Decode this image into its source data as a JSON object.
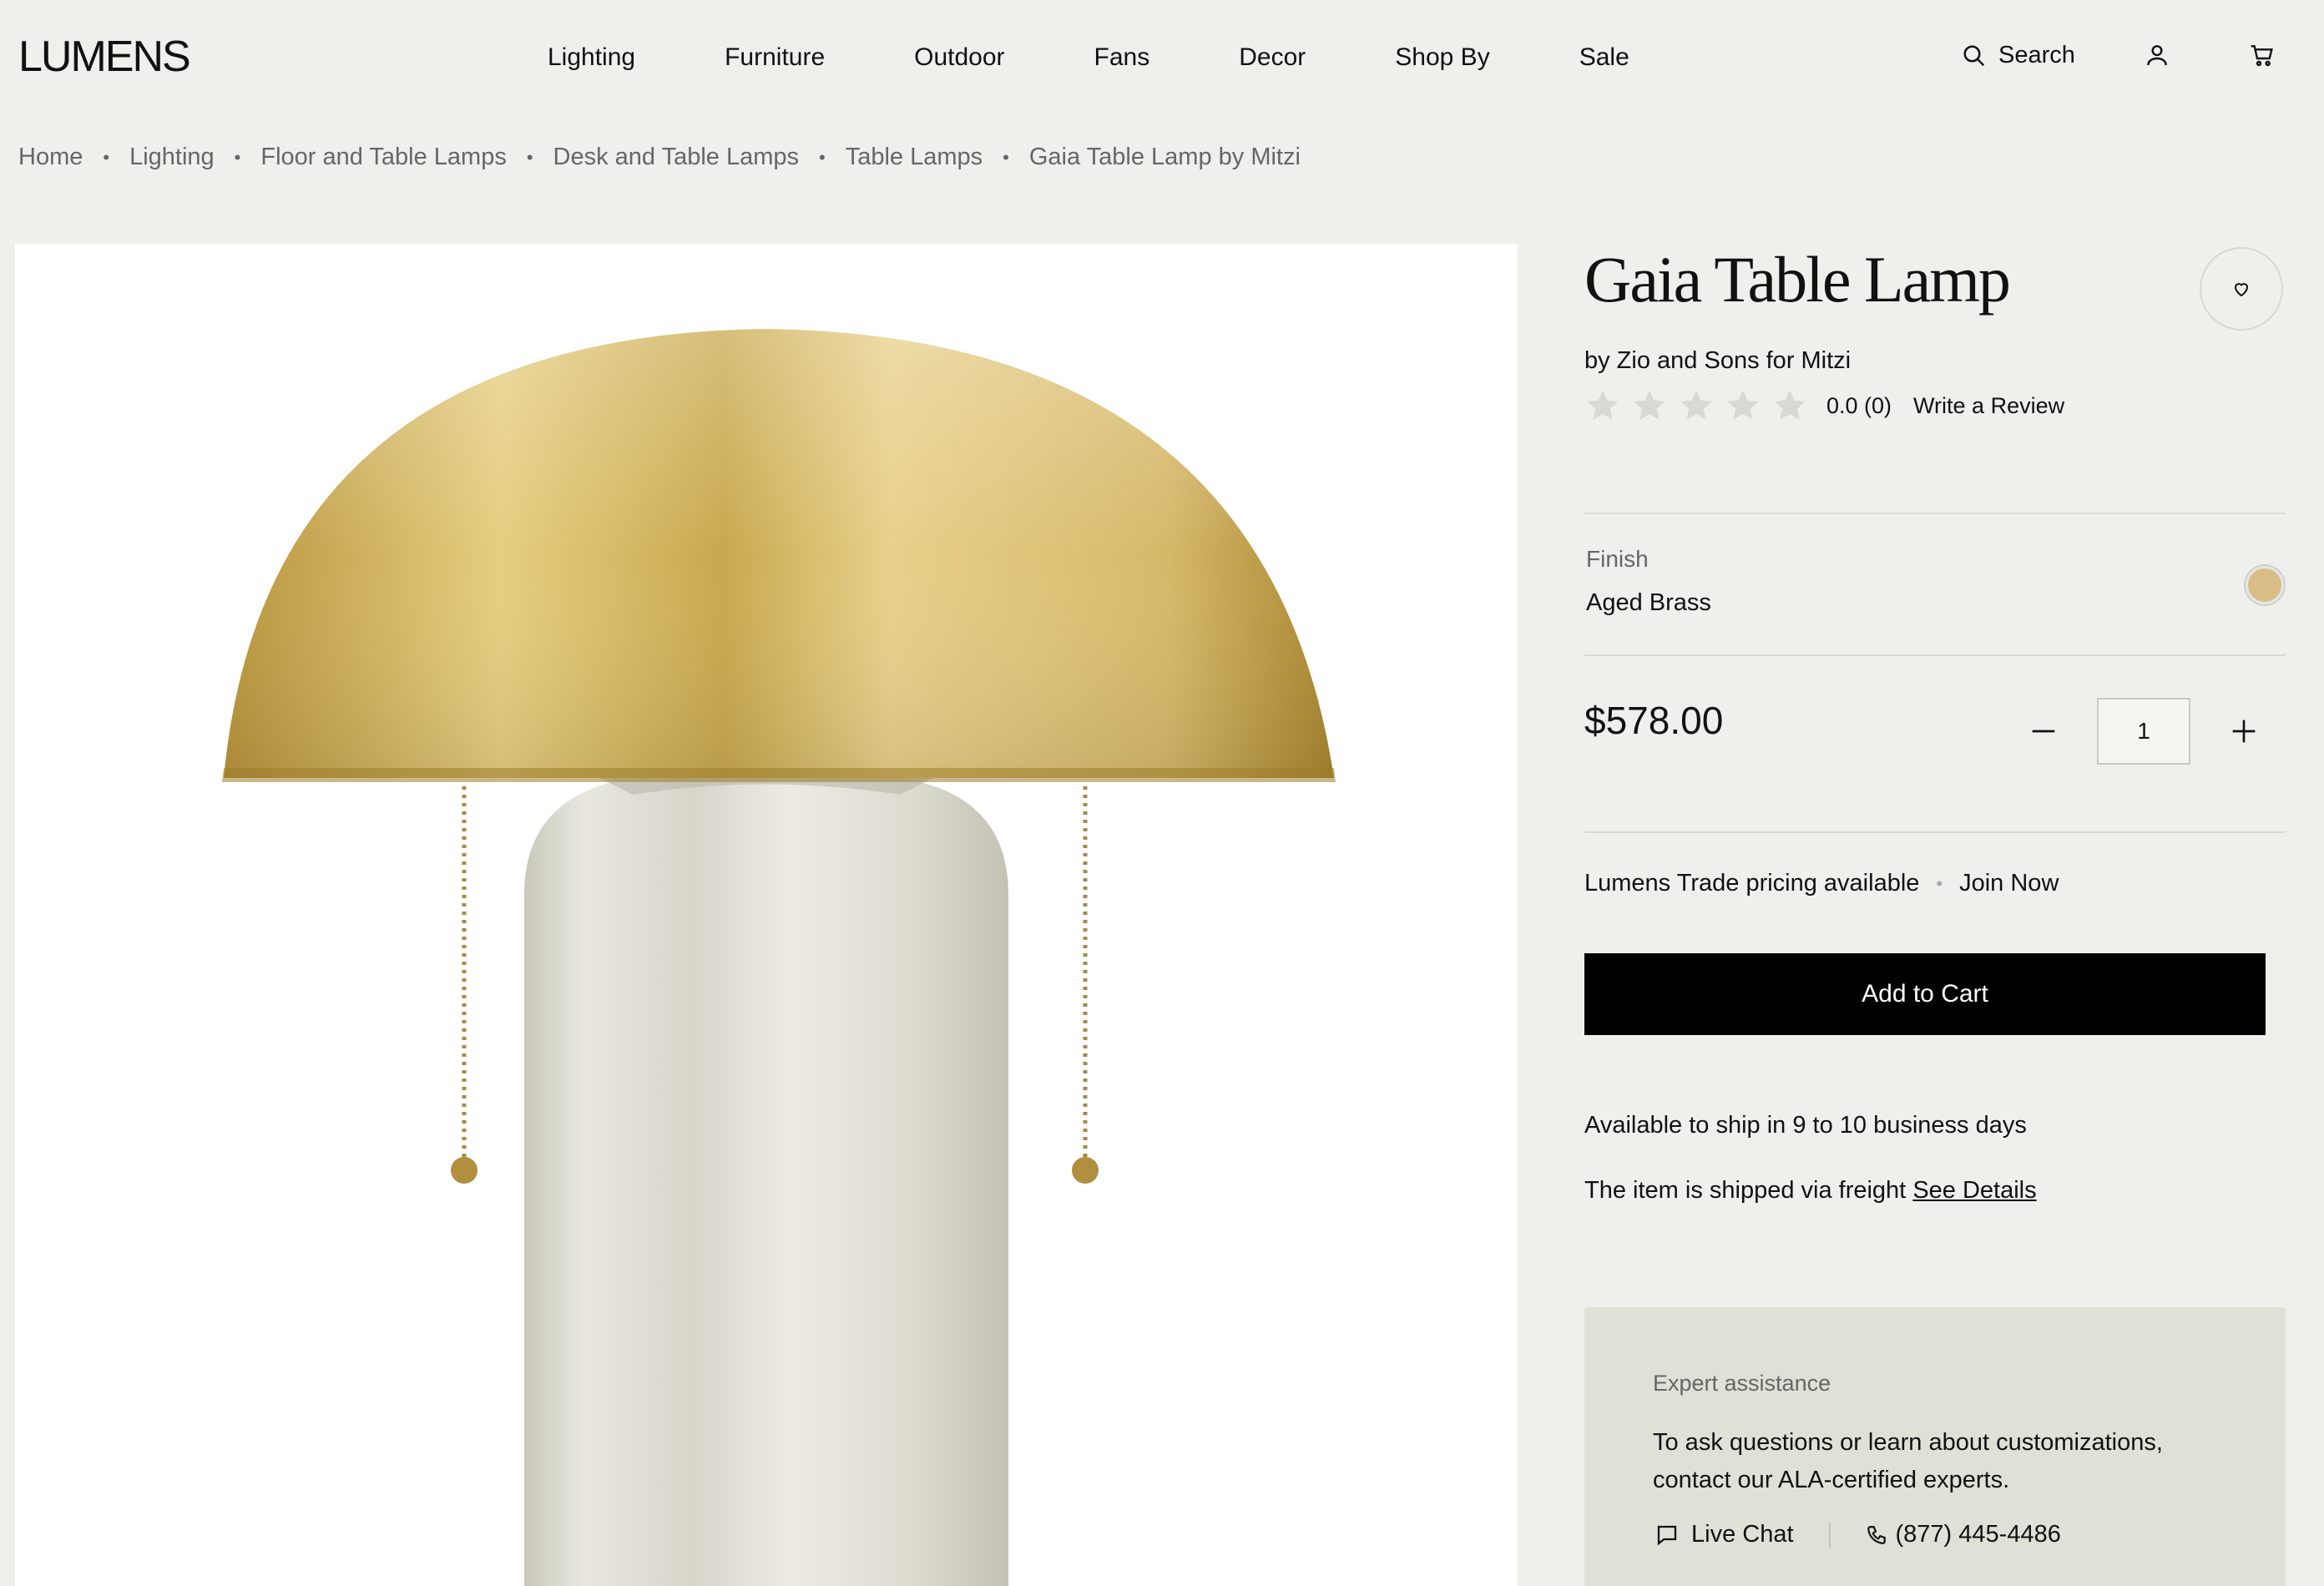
{
  "header": {
    "logo": "LUMENS",
    "nav": [
      "Lighting",
      "Furniture",
      "Outdoor",
      "Fans",
      "Decor",
      "Shop By",
      "Sale"
    ],
    "search_label": "Search"
  },
  "breadcrumb": [
    "Home",
    "Lighting",
    "Floor and Table Lamps",
    "Desk and Table Lamps",
    "Table Lamps",
    "Gaia Table Lamp by Mitzi"
  ],
  "product": {
    "title": "Gaia Table Lamp",
    "brand": "by Zio and Sons for Mitzi",
    "rating": {
      "stars_filled": 0,
      "stars_total": 5,
      "value_text": "0.0 (0)",
      "write_review": "Write a Review"
    },
    "finish": {
      "label": "Finish",
      "value": "Aged Brass",
      "swatch_color": "#d9bc86"
    },
    "price": "$578.00",
    "quantity": "1",
    "trade_text": "Lumens Trade pricing available",
    "trade_join": "Join Now",
    "add_to_cart": "Add to Cart",
    "shipping": "Available to ship in 9 to 10 business days",
    "freight_text": "The item is shipped via freight ",
    "freight_link": "See Details"
  },
  "expert": {
    "title": "Expert assistance",
    "body": "To ask questions or learn about customizations, contact our ALA-certified experts.",
    "live_chat": "Live Chat",
    "phone": "(877) 445-4486"
  },
  "colors": {
    "page_bg": "#eff0ec",
    "button_bg": "#000000",
    "expert_bg": "#dfe0d6",
    "brass": "#c9a94e"
  }
}
